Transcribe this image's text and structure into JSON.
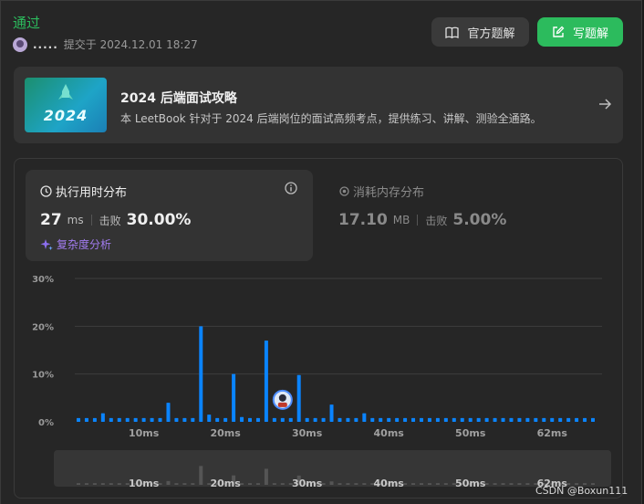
{
  "status": "通过",
  "submission": {
    "user": ".....",
    "submitted_at": "提交于 2024.12.01 18:27"
  },
  "buttons": {
    "official": "官方题解",
    "write": "写题解"
  },
  "banner": {
    "cover_year": "2024",
    "title": "2024 后端面试攻略",
    "description": "本 LeetBook 针对于 2024 后端岗位的面试高频考点，提供练习、讲解、测验全通路。"
  },
  "runtime": {
    "label": "执行用时分布",
    "value": "27",
    "unit": "ms",
    "beat_label": "击败",
    "beat_value": "30.00%",
    "complexity_link": "复杂度分析"
  },
  "memory": {
    "label": "消耗内存分布",
    "value": "17.10",
    "unit": "MB",
    "beat_label": "击败",
    "beat_value": "5.00%"
  },
  "watermark": "CSDN @Boxun111",
  "colors": {
    "accent_green": "#2cbb5d",
    "bar_blue": "#0a84ff",
    "purple": "#a27cf0"
  },
  "chart_data": {
    "type": "bar",
    "title": "",
    "xlabel": "",
    "ylabel": "",
    "ylim": [
      0,
      30
    ],
    "y_ticks": [
      "0%",
      "10%",
      "20%",
      "30%"
    ],
    "x_ticks": [
      {
        "label": "10ms",
        "value": 10
      },
      {
        "label": "20ms",
        "value": 20
      },
      {
        "label": "30ms",
        "value": 30
      },
      {
        "label": "40ms",
        "value": 40
      },
      {
        "label": "50ms",
        "value": 50
      },
      {
        "label": "62ms",
        "value": 60
      }
    ],
    "x": [
      2,
      3,
      4,
      5,
      6,
      7,
      8,
      9,
      10,
      11,
      12,
      13,
      14,
      15,
      16,
      17,
      18,
      19,
      20,
      21,
      22,
      23,
      24,
      25,
      26,
      27,
      28,
      29,
      30,
      31,
      32,
      33,
      34,
      35,
      36,
      37,
      38,
      39,
      40,
      41,
      42,
      43,
      44,
      45,
      46,
      47,
      48,
      49,
      50,
      51,
      52,
      53,
      54,
      55,
      56,
      57,
      58,
      59,
      60,
      61,
      62,
      63,
      64,
      65
    ],
    "values": [
      0.8,
      0.8,
      0.8,
      1.8,
      0.8,
      0.8,
      0.8,
      0.8,
      0.8,
      0.8,
      0.8,
      4.0,
      0.8,
      0.8,
      0.8,
      20.0,
      1.5,
      0.8,
      0.8,
      10.0,
      1.0,
      0.8,
      0.8,
      17.0,
      0.8,
      0.8,
      0.8,
      9.8,
      0.8,
      0.8,
      0.8,
      3.6,
      0.8,
      0.8,
      0.8,
      1.8,
      0.8,
      0.8,
      0.8,
      0.8,
      0.8,
      0.8,
      0.8,
      0.8,
      0.8,
      0.8,
      0.8,
      0.8,
      0.8,
      0.8,
      0.8,
      0.8,
      0.8,
      0.8,
      0.8,
      0.8,
      0.8,
      0.8,
      0.8,
      0.8,
      0.8,
      0.8,
      0.8,
      0.8
    ],
    "highlight_x": 27,
    "grid": true
  }
}
